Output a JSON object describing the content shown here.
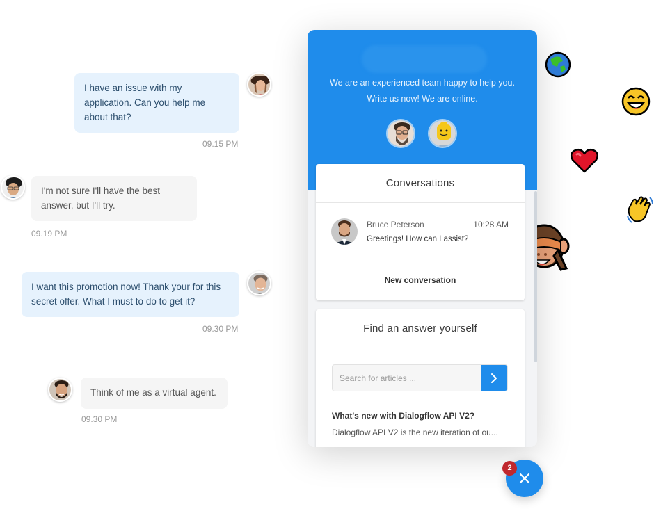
{
  "chat_messages": [
    {
      "side": "outgoing",
      "text": "I have an issue with my application. Can you help me about that?",
      "time": "09.15 PM",
      "avatar": "woman-with-hat-avatar"
    },
    {
      "side": "incoming",
      "text": "I'm not sure I'll have the best answer, but I'll try.",
      "time": "09.19 PM",
      "avatar": "man-with-glasses-avatar"
    },
    {
      "side": "outgoing",
      "text": "I want this promotion now! Thank your for this secret offer. What I must to do to get it?",
      "time": "09.30 PM",
      "avatar": "smiling-man-avatar"
    },
    {
      "side": "incoming",
      "text": "Think of me as a virtual agent.",
      "time": "09.30 PM",
      "avatar": "bearded-man-avatar"
    }
  ],
  "panel": {
    "tagline_1": "We are an experienced team happy to help you.",
    "tagline_2": "Write us now! We are online.",
    "agents": [
      "bearded-agent",
      "lego-face-agent"
    ],
    "conversations": {
      "title": "Conversations",
      "items": [
        {
          "name": "Bruce Peterson",
          "time": "10:28 AM",
          "message": "Greetings! How can I assist?"
        }
      ],
      "new_conversation_label": "New conversation"
    },
    "find_answer": {
      "title": "Find an answer yourself",
      "search_placeholder": "Search for articles ...",
      "search_value": "",
      "articles": [
        {
          "title": "What's new with Dialogflow API V2?",
          "excerpt": "Dialogflow API V2 is the new iteration of ou..."
        }
      ]
    }
  },
  "launcher": {
    "badge_count": "2",
    "icon": "close-icon"
  },
  "emojis": [
    "globe-emoji",
    "grinning-face-emoji",
    "red-heart-emoji",
    "waving-hand-emoji",
    "see-no-evil-monkey-emoji"
  ],
  "colors": {
    "accent": "#1f8ceb",
    "badge": "#c0282e",
    "outgoing_bubble": "#e6f2fd",
    "incoming_bubble": "#f5f5f5"
  }
}
